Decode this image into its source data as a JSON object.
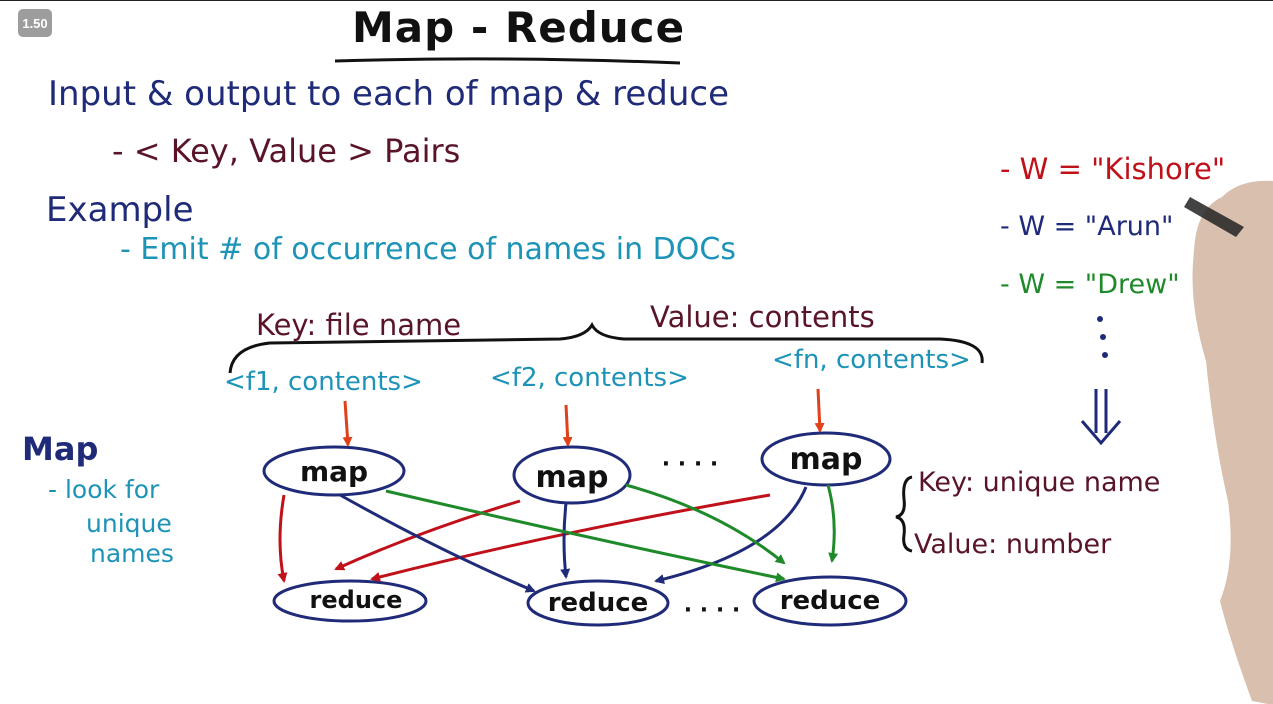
{
  "speed_badge": "1.50",
  "title": "Map - Reduce",
  "intro": {
    "line1": "Input & output to each of map & reduce",
    "bullet": "- < Key, Value > Pairs",
    "example_heading": "Example",
    "example_bullet": "- Emit # of occurrence of names in DOCs"
  },
  "input_pair": {
    "key_label": "Key: file name",
    "value_label": "Value: contents",
    "records": [
      "<f1, contents>",
      "<f2, contents>",
      "<fn, contents>"
    ]
  },
  "map_notes": {
    "heading": "Map",
    "desc_lines": [
      "- look for",
      "unique",
      "names"
    ]
  },
  "nodes": {
    "maps": [
      "map",
      "map",
      "map"
    ],
    "map_ellipsis": "· · · ·",
    "reduces": [
      "reduce",
      "reduce",
      "reduce"
    ],
    "reduce_ellipsis": "· · · ·"
  },
  "output_pair": {
    "key_label": "Key: unique name",
    "value_label": "Value: number"
  },
  "emitted": [
    {
      "text": "- W = \"Kishore\"",
      "color": "#c0101a"
    },
    {
      "text": "- W = \"Arun\"",
      "color": "#1f2a78"
    },
    {
      "text": "- W = \"Drew\"",
      "color": "#1f8a2a"
    }
  ],
  "colors": {
    "navy": "#1f2a78",
    "teal": "#1e93b8",
    "maroon": "#5a1428",
    "red": "#c0101a",
    "green": "#1f8a2a",
    "badge": "#9d9d9d"
  }
}
